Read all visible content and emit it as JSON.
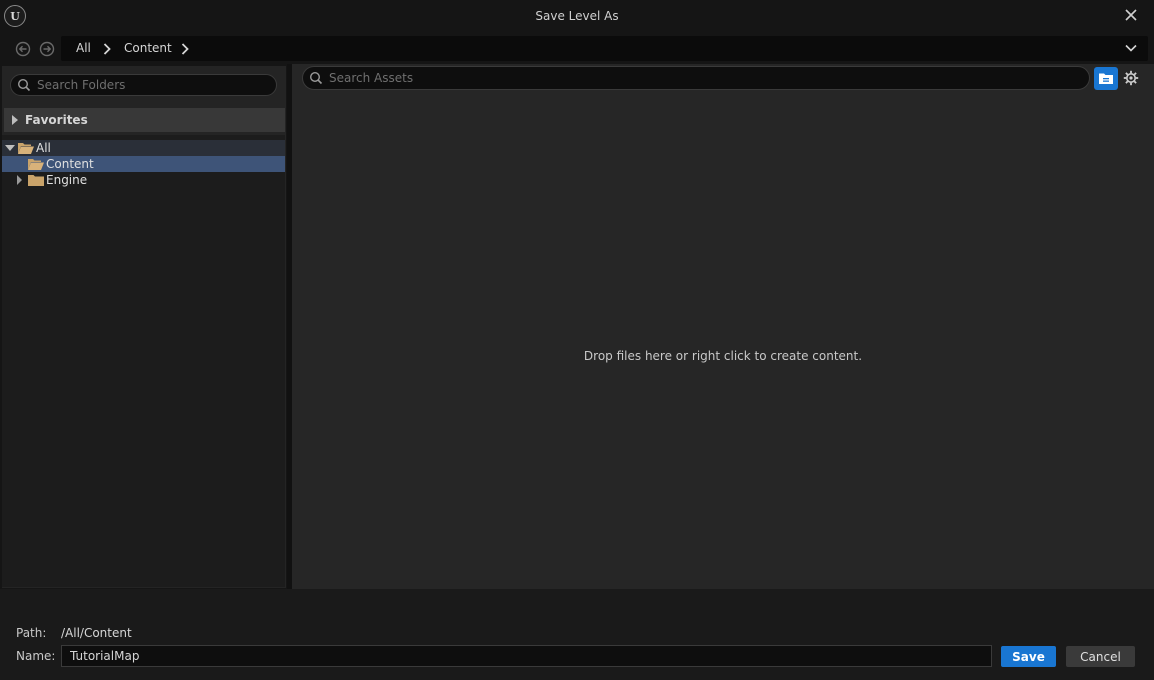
{
  "window": {
    "title": "Save Level As",
    "logo_text": "U"
  },
  "breadcrumb": [
    "All",
    "Content"
  ],
  "folder_search": {
    "placeholder": "Search Folders"
  },
  "favorites": {
    "label": "Favorites"
  },
  "tree": {
    "root": "All",
    "items": [
      {
        "label": "Content",
        "selected": true,
        "expandable": false
      },
      {
        "label": "Engine",
        "selected": false,
        "expandable": true
      }
    ]
  },
  "asset_search": {
    "placeholder": "Search Assets"
  },
  "content_area": {
    "empty_hint": "Drop files here or right click to create content."
  },
  "footer": {
    "path_label": "Path:",
    "path_value": "/All/Content",
    "name_label": "Name:",
    "name_value": "TutorialMap",
    "save_label": "Save",
    "cancel_label": "Cancel"
  },
  "colors": {
    "accent": "#1976d2",
    "selection": "#3e5478",
    "folder": "#c9a36a"
  }
}
